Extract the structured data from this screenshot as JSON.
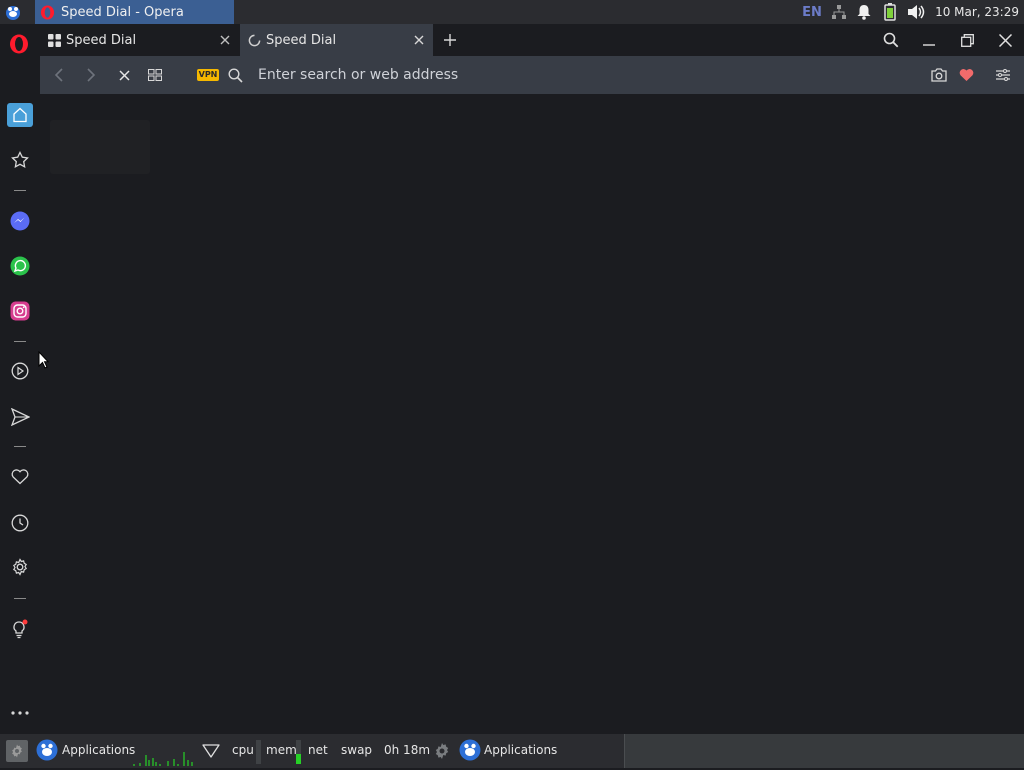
{
  "system_panel": {
    "window_title": "Speed Dial - Opera",
    "keyboard_layout": "EN",
    "clock": "10 Mar, 23:29"
  },
  "browser": {
    "tabs": [
      {
        "title": "Speed Dial",
        "active": false,
        "loading": false
      },
      {
        "title": "Speed Dial",
        "active": true,
        "loading": true
      }
    ],
    "address_bar": {
      "placeholder": "Enter search or web address",
      "vpn_badge": "VPN"
    },
    "sidebar": {
      "items": [
        "home",
        "bookmarks",
        "messenger",
        "whatsapp",
        "instagram",
        "player",
        "send",
        "favorites",
        "history",
        "settings",
        "tips",
        "more"
      ]
    }
  },
  "bottom_panel": {
    "applications_label": "Applications",
    "cpu_label": "cpu",
    "mem_label": "mem",
    "net_label": "net",
    "swap_label": "swap",
    "uptime": "0h 18m",
    "applications_label_2": "Applications"
  },
  "colors": {
    "accent_blue": "#4aa0d9",
    "opera_red": "#ff1b2d",
    "vpn_yellow": "#f5b800",
    "taskbar_active": "#3b5f93"
  }
}
